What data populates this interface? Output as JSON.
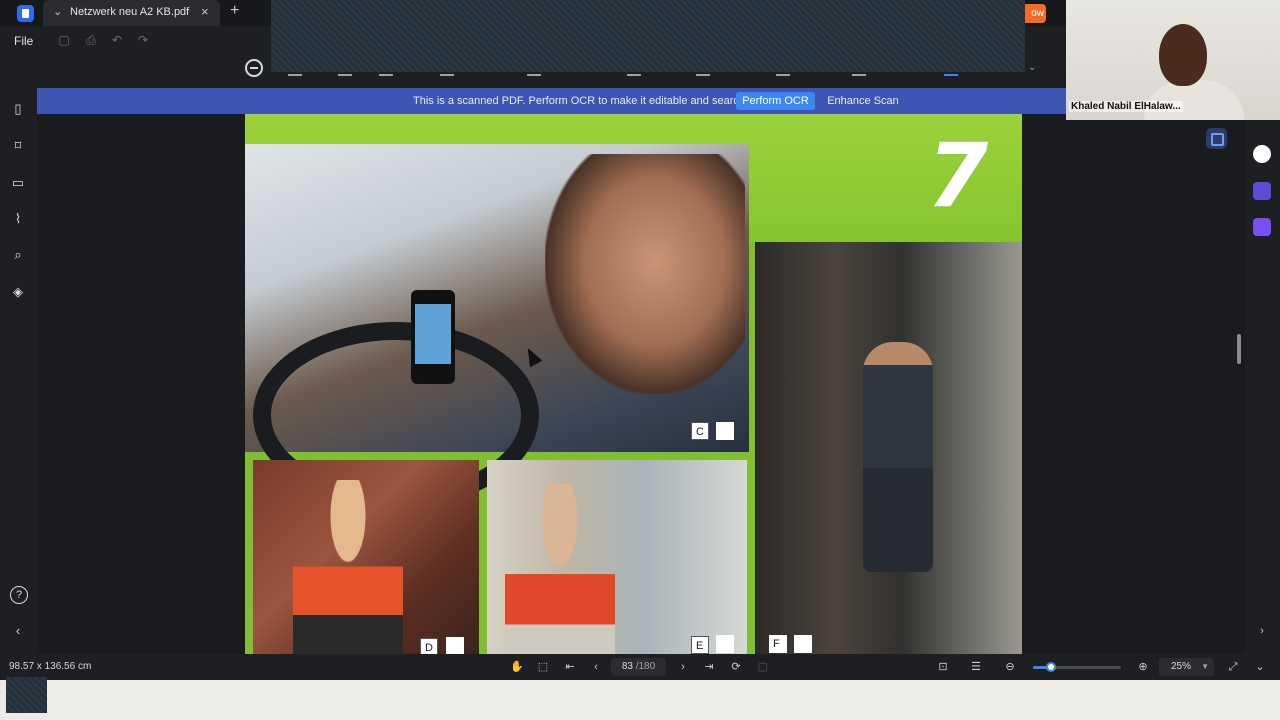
{
  "tab": {
    "title": "Netzwerk neu A2 KB.pdf",
    "close": "×",
    "new_tab": "+"
  },
  "promo": {
    "label": "ow"
  },
  "menu": {
    "file": "File"
  },
  "ocr_banner": {
    "message": "This is a scanned PDF. Perform OCR to make it editable and searchable.",
    "perform_ocr": "Perform OCR",
    "enhance_scan": "Enhance Scan"
  },
  "page_content": {
    "chapter_number": "7",
    "labels": {
      "c": "C",
      "d": "D",
      "e": "E",
      "f": "F"
    }
  },
  "status": {
    "dimensions": "98.57 x 136.56 cm",
    "current_page": "83",
    "total_pages": "/180",
    "zoom": "25%",
    "zoom_fraction": 0.2
  },
  "video_call": {
    "participant_name": "Khaled Nabil ElHalaw..."
  },
  "colors": {
    "accent": "#3d87f5",
    "banner": "#3d55b3",
    "page_green": "#8cc63f",
    "promo": "#f46b2a"
  },
  "icons": {
    "sidebar": [
      "page-icon",
      "bookmark-icon",
      "comment-icon",
      "attachment-icon",
      "search-icon",
      "layers-icon",
      "help-icon",
      "collapse-left-icon"
    ],
    "right_rail": [
      "ai-assistant-icon",
      "translate-icon",
      "check-icon",
      "expand-right-icon"
    ]
  }
}
